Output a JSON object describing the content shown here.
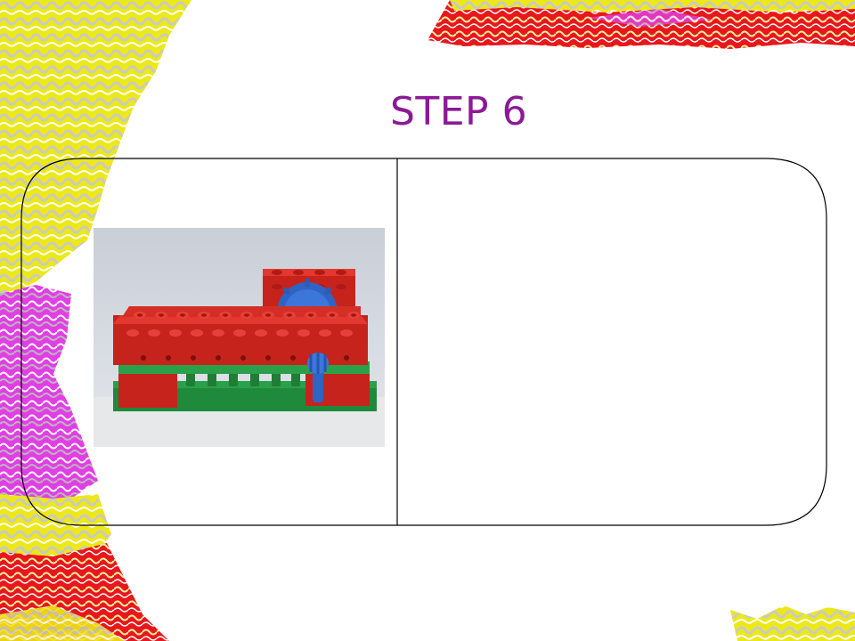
{
  "slide": {
    "title": "STEP 6"
  },
  "colors": {
    "title": "#8b1a96",
    "frame_stroke": "#000000",
    "decor_yellow": "#ece81a",
    "decor_magenta": "#e23ee6",
    "decor_red": "#e8171c"
  },
  "image": {
    "subject": "red-and-green-duplo-gear-model-photo"
  }
}
